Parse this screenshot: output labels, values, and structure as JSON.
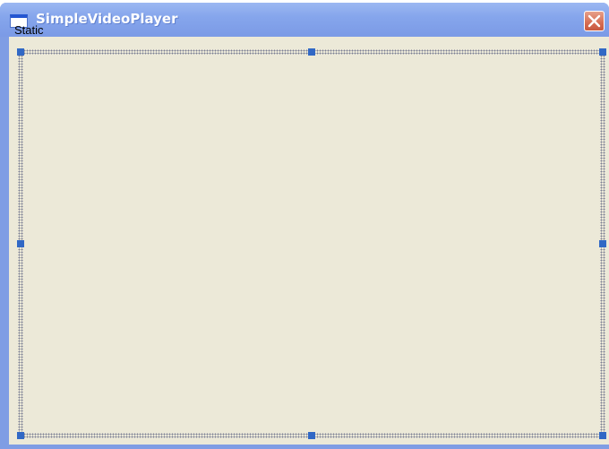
{
  "window": {
    "title": "SimpleVideoPlayer"
  },
  "icons": {
    "app": "app-window-icon",
    "close": "close-icon"
  },
  "static_control": {
    "text": "Static",
    "selected": true
  },
  "colors": {
    "titlebar": "#7b9ae6",
    "client_bg": "#ece9d8",
    "handle": "#3168c5",
    "close_button": "#d66d54"
  }
}
